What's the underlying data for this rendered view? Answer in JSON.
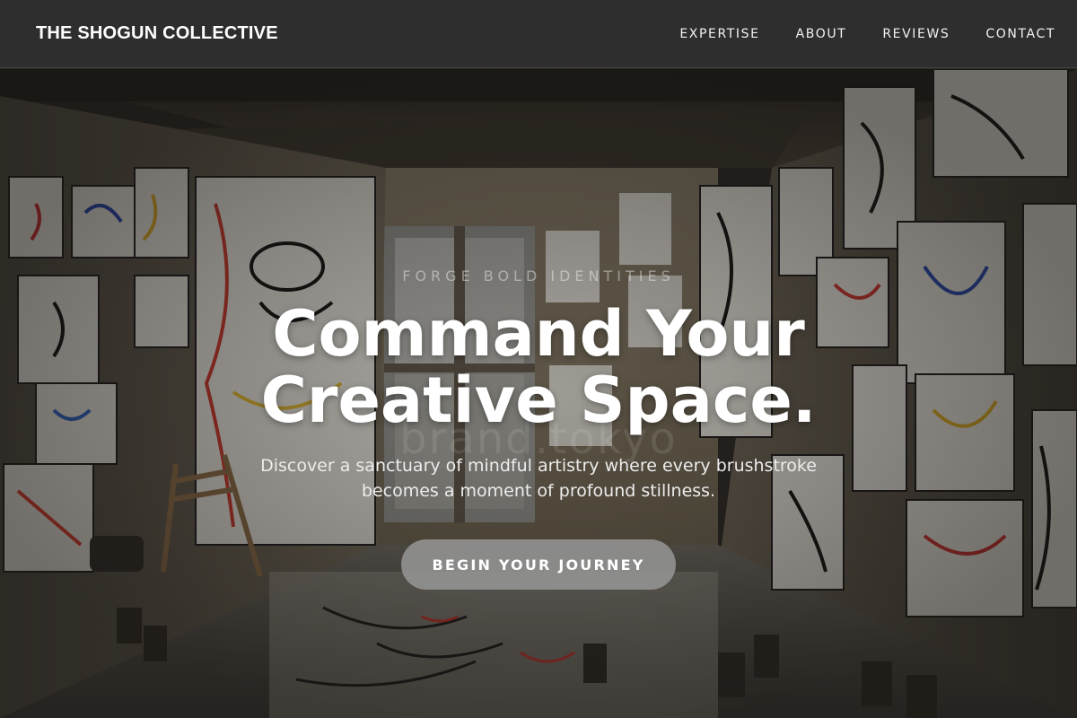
{
  "header": {
    "brand": "THE SHOGUN COLLECTIVE",
    "nav": [
      "EXPERTISE",
      "ABOUT",
      "REVIEWS",
      "CONTACT"
    ]
  },
  "hero": {
    "eyebrow": "FORGE BOLD IDENTITIES",
    "headline_line1": "Command Your",
    "headline_line2": "Creative Space.",
    "watermark": "brand.tokyo",
    "subtext": "Discover a sanctuary of mindful artistry where every brushstroke becomes a moment of profound stillness.",
    "cta_label": "BEGIN YOUR JOURNEY",
    "background_image": "artist-studio-room-with-drawings"
  },
  "colors": {
    "header_bg": "#2e2e2e",
    "cta_bg": "#969696",
    "text": "#ffffff"
  }
}
